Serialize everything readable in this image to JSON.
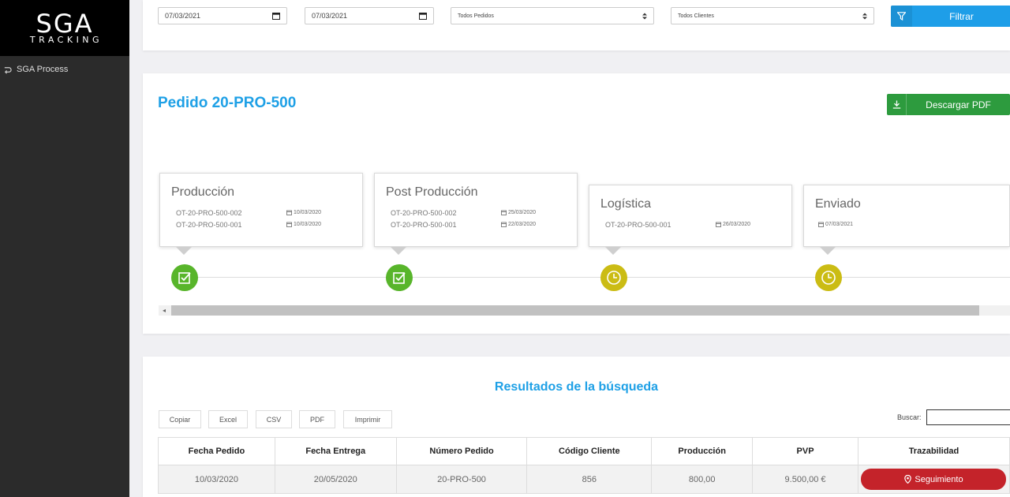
{
  "app": {
    "logo_main": "SGA",
    "logo_sub": "TRACKING"
  },
  "sidebar": {
    "items": [
      {
        "label": "SGA Process",
        "icon": "process-icon"
      }
    ]
  },
  "filters": {
    "date_from": "07/03/2021",
    "date_to": "07/03/2021",
    "orders_select": "Todos Pedidos",
    "clients_select": "Todos Clientes",
    "filter_button": "Filtrar"
  },
  "order": {
    "title": "Pedido 20-PRO-500",
    "pdf_button": "Descargar PDF",
    "stages": [
      {
        "title": "Producción",
        "status": "done",
        "rows": [
          {
            "ot": "OT-20-PRO-500-002",
            "date": "10/03/2020"
          },
          {
            "ot": "OT-20-PRO-500-001",
            "date": "10/03/2020"
          }
        ]
      },
      {
        "title": "Post Producción",
        "status": "done",
        "rows": [
          {
            "ot": "OT-20-PRO-500-002",
            "date": "25/03/2020"
          },
          {
            "ot": "OT-20-PRO-500-001",
            "date": "22/03/2020"
          }
        ]
      },
      {
        "title": "Logística",
        "status": "pending",
        "rows": [
          {
            "ot": "OT-20-PRO-500-001",
            "date": "26/03/2020"
          }
        ]
      },
      {
        "title": "Enviado",
        "status": "pending",
        "rows": [
          {
            "ot": "",
            "date": "07/03/2021"
          }
        ]
      }
    ],
    "colors": {
      "done": "#58b52b",
      "pending": "#cbbc14"
    }
  },
  "results": {
    "title": "Resultados de la búsqueda",
    "export_buttons": [
      "Copiar",
      "Excel",
      "CSV",
      "PDF",
      "Imprimir"
    ],
    "search_label": "Buscar:",
    "search_value": "",
    "columns": [
      "Fecha Pedido",
      "Fecha Entrega",
      "Número Pedido",
      "Código Cliente",
      "Producción",
      "PVP",
      "Trazabilidad"
    ],
    "rows": [
      {
        "fecha_pedido": "10/03/2020",
        "fecha_entrega": "20/05/2020",
        "numero_pedido": "20-PRO-500",
        "codigo_cliente": "856",
        "produccion": "800,00",
        "pvp": "9.500,00 €",
        "trazabilidad": "Seguimiento"
      }
    ]
  },
  "colors": {
    "accent": "#1ea0e6",
    "success": "#2d9b3e",
    "danger": "#c4232a",
    "sidebar": "#2b2b2b"
  }
}
